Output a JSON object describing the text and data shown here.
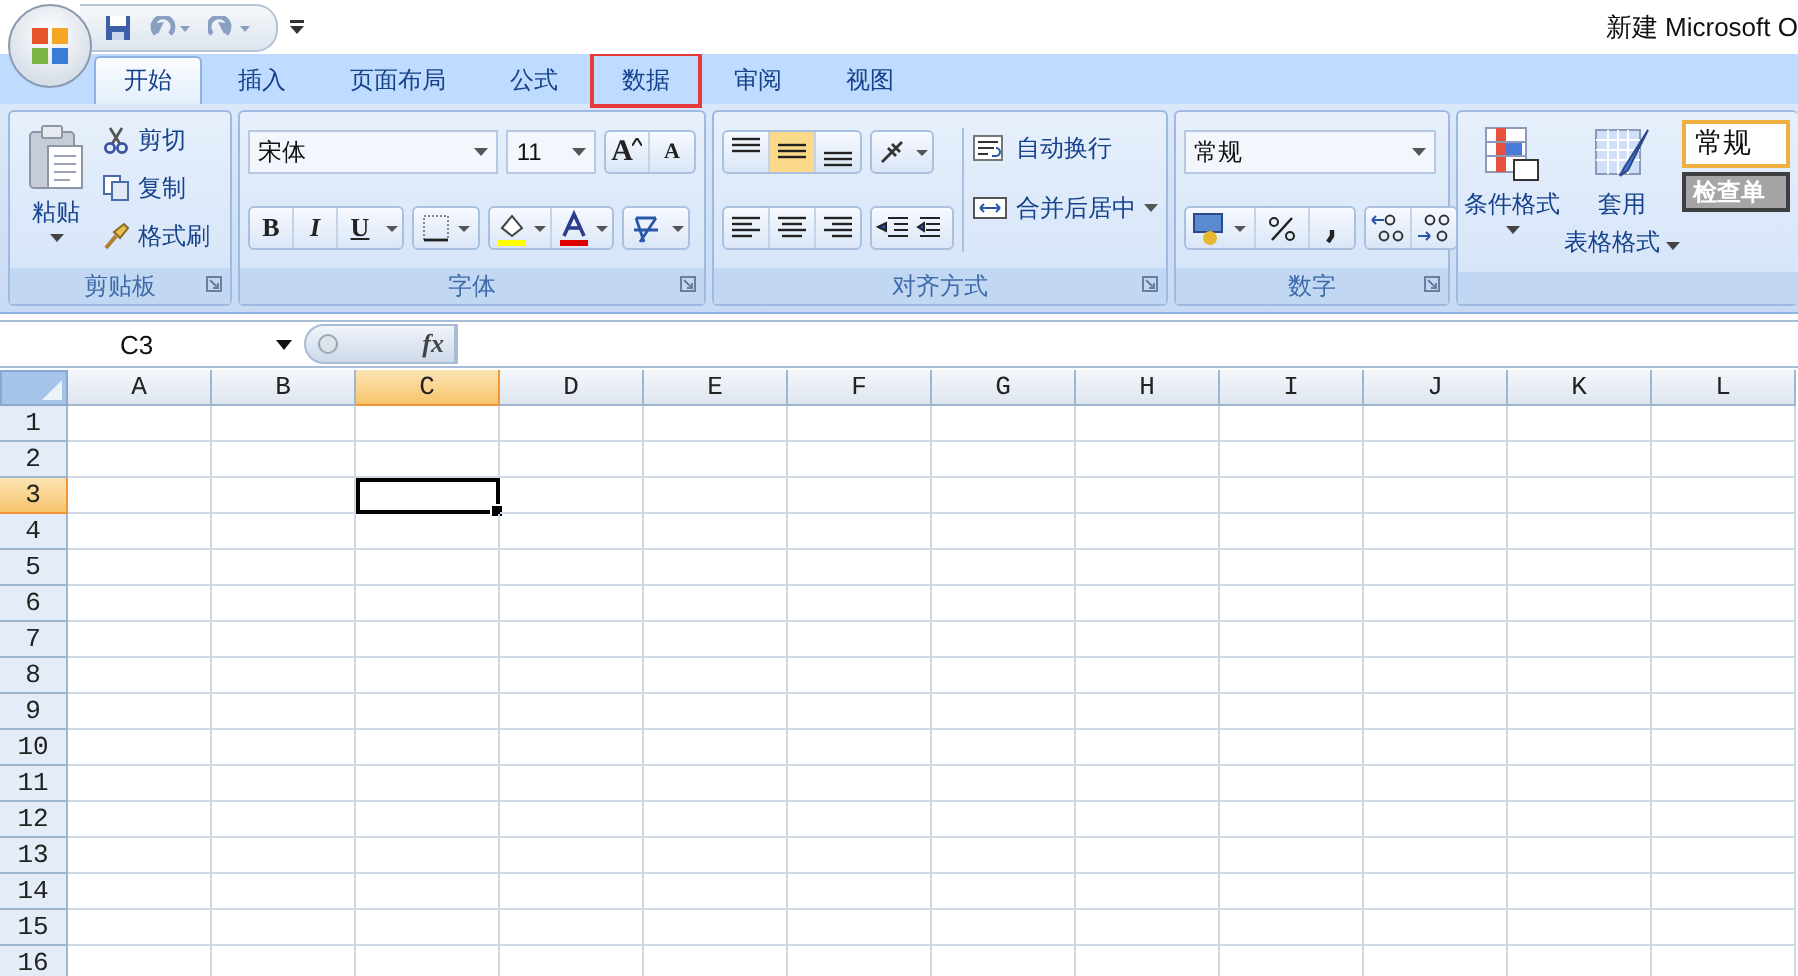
{
  "window": {
    "title": "新建 Microsoft O"
  },
  "tabs": [
    {
      "label": "开始",
      "selected": true,
      "highlighted": false
    },
    {
      "label": "插入",
      "selected": false,
      "highlighted": false
    },
    {
      "label": "页面布局",
      "selected": false,
      "highlighted": false
    },
    {
      "label": "公式",
      "selected": false,
      "highlighted": false
    },
    {
      "label": "数据",
      "selected": false,
      "highlighted": true
    },
    {
      "label": "审阅",
      "selected": false,
      "highlighted": false
    },
    {
      "label": "视图",
      "selected": false,
      "highlighted": false
    }
  ],
  "clipboard": {
    "label": "剪贴板",
    "paste": "粘贴",
    "cut": "剪切",
    "copy": "复制",
    "format_painter": "格式刷"
  },
  "font": {
    "label": "字体",
    "font_name": "宋体",
    "font_size": "11",
    "grow": "A",
    "shrink": "A",
    "bold": "B",
    "italic": "I",
    "underline": "U"
  },
  "alignment": {
    "label": "对齐方式",
    "vertical": [
      {
        "kind": "top",
        "selected": false
      },
      {
        "kind": "middle",
        "selected": true
      },
      {
        "kind": "bottom",
        "selected": false
      }
    ],
    "horizontal": [
      {
        "kind": "left",
        "selected": false
      },
      {
        "kind": "center",
        "selected": false
      },
      {
        "kind": "right",
        "selected": false
      }
    ],
    "wrap_text": "自动换行",
    "merge_center": "合并后居中"
  },
  "number": {
    "label": "数字",
    "format": "常规"
  },
  "styles": {
    "conditional_format": "条件格式",
    "table_format_1": "套用",
    "table_format_2": "表格格式",
    "cell_style": "常规",
    "check_cell": "检查单"
  },
  "formula_bar": {
    "name_box": "C3",
    "fx": "fx"
  },
  "columns": [
    {
      "label": "A",
      "selected": false
    },
    {
      "label": "B",
      "selected": false
    },
    {
      "label": "C",
      "selected": true
    },
    {
      "label": "D",
      "selected": false
    },
    {
      "label": "E",
      "selected": false
    },
    {
      "label": "F",
      "selected": false
    },
    {
      "label": "G",
      "selected": false
    },
    {
      "label": "H",
      "selected": false
    },
    {
      "label": "I",
      "selected": false
    },
    {
      "label": "J",
      "selected": false
    },
    {
      "label": "K",
      "selected": false
    },
    {
      "label": "L",
      "selected": false
    }
  ],
  "rows": [
    {
      "label": "1",
      "selected": false
    },
    {
      "label": "2",
      "selected": false
    },
    {
      "label": "3",
      "selected": true
    },
    {
      "label": "4",
      "selected": false
    },
    {
      "label": "5",
      "selected": false
    },
    {
      "label": "6",
      "selected": false
    },
    {
      "label": "7",
      "selected": false
    },
    {
      "label": "8",
      "selected": false
    },
    {
      "label": "9",
      "selected": false
    },
    {
      "label": "10",
      "selected": false
    },
    {
      "label": "11",
      "selected": false
    },
    {
      "label": "12",
      "selected": false
    },
    {
      "label": "13",
      "selected": false
    },
    {
      "label": "14",
      "selected": false
    },
    {
      "label": "15",
      "selected": false
    },
    {
      "label": "16",
      "selected": false
    }
  ]
}
